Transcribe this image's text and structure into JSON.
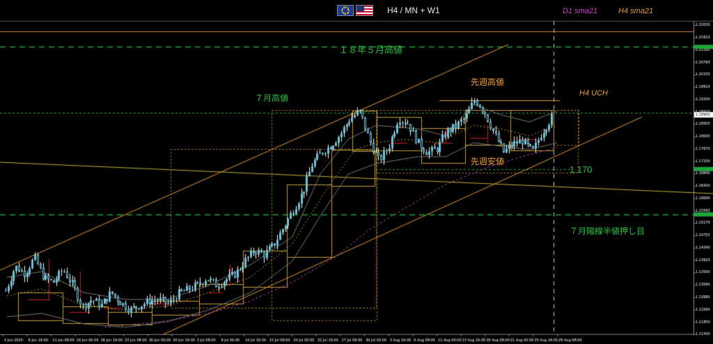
{
  "header": {
    "title": "H4 / MN + W1",
    "flag_left_icon": "eu-flag-icon",
    "flag_right_icon": "us-flag-icon",
    "legend_d1": "D1 sma21",
    "legend_h4": "H4 sma21"
  },
  "annotations": {
    "may2018_high": "１８年５月高値",
    "july_high": "７月高値",
    "last_week_high": "先週高値",
    "last_week_low": "先週安値",
    "h4_uch": "H4 UCH",
    "level_1170": "1.170",
    "july_half_retrace": "７月陽線半値押し目"
  },
  "colors": {
    "background": "#000000",
    "candle_body": "#6fc6dd",
    "wick": "#ffffff",
    "channel": "#e8a030",
    "green_dashed": "#1fa63a",
    "box_outline": "#c8a030",
    "sma_d1": "#c040c0",
    "sma_h4": "#d4a040",
    "red_marker": "#d02020",
    "separator": "#888888"
  },
  "chart_data": {
    "type": "candlestick",
    "x_axis": {
      "tick_labels": [
        "4 Jun 2020",
        "8 Jun 16:00",
        "11 Jun 08:00",
        "16 Jun 00:00",
        "18 Jun 16:00",
        "23 Jun 08:00",
        "26 Jun 00:00",
        "30 Jun 16:00",
        "3 Jul 08:00",
        "8 Jul 00:00",
        "10 Jul 16:00",
        "15 Jul 08:00",
        "20 Jul 00:00",
        "22 Jul 16:00",
        "27 Jul 08:00",
        "30 Jul 00:00",
        "3 Aug 16:00",
        "6 Aug 08:00",
        "11 Aug 00:00",
        "13 Aug 16:00",
        "18 Aug 08:00",
        "21 Aug 00:00",
        "25 Aug 16:00",
        "28 Aug 08:00"
      ]
    },
    "y_axis": {
      "tick_labels": [
        "1.22035",
        "1.21610",
        "1.21185",
        "1.20760",
        "1.20335",
        "1.19910",
        "1.19330",
        "1.18920",
        "1.18505",
        "1.18095",
        "1.17670",
        "1.17250",
        "1.16840",
        "1.16420",
        "1.16000",
        "1.15595",
        "1.15170",
        "1.14755",
        "1.14340",
        "1.13925",
        "1.13500",
        "1.13090",
        "1.12680",
        "1.12260",
        "1.11850",
        "1.11430"
      ],
      "range": [
        1.113,
        1.2215
      ]
    },
    "current_price": 1.189,
    "horizontal_levels": [
      {
        "name": "may2018_high",
        "price": 1.2125
      },
      {
        "name": "july_high",
        "price": 1.1896
      },
      {
        "name": "level_1170",
        "price": 1.17
      },
      {
        "name": "july_half_retrace",
        "price": 1.1545
      }
    ],
    "close_path": [
      1.128,
      1.1365,
      1.134,
      1.1395,
      1.1325,
      1.131,
      1.1355,
      1.13,
      1.1225,
      1.125,
      1.123,
      1.1275,
      1.124,
      1.1215,
      1.123,
      1.1245,
      1.125,
      1.1235,
      1.127,
      1.1285,
      1.13,
      1.1325,
      1.13,
      1.132,
      1.134,
      1.1385,
      1.142,
      1.1405,
      1.144,
      1.15,
      1.156,
      1.162,
      1.172,
      1.176,
      1.1785,
      1.1825,
      1.188,
      1.19,
      1.18,
      1.173,
      1.178,
      1.188,
      1.186,
      1.1795,
      1.176,
      1.177,
      1.183,
      1.185,
      1.188,
      1.1945,
      1.19,
      1.1825,
      1.176,
      1.179,
      1.18,
      1.176,
      1.183,
      1.188
    ]
  }
}
